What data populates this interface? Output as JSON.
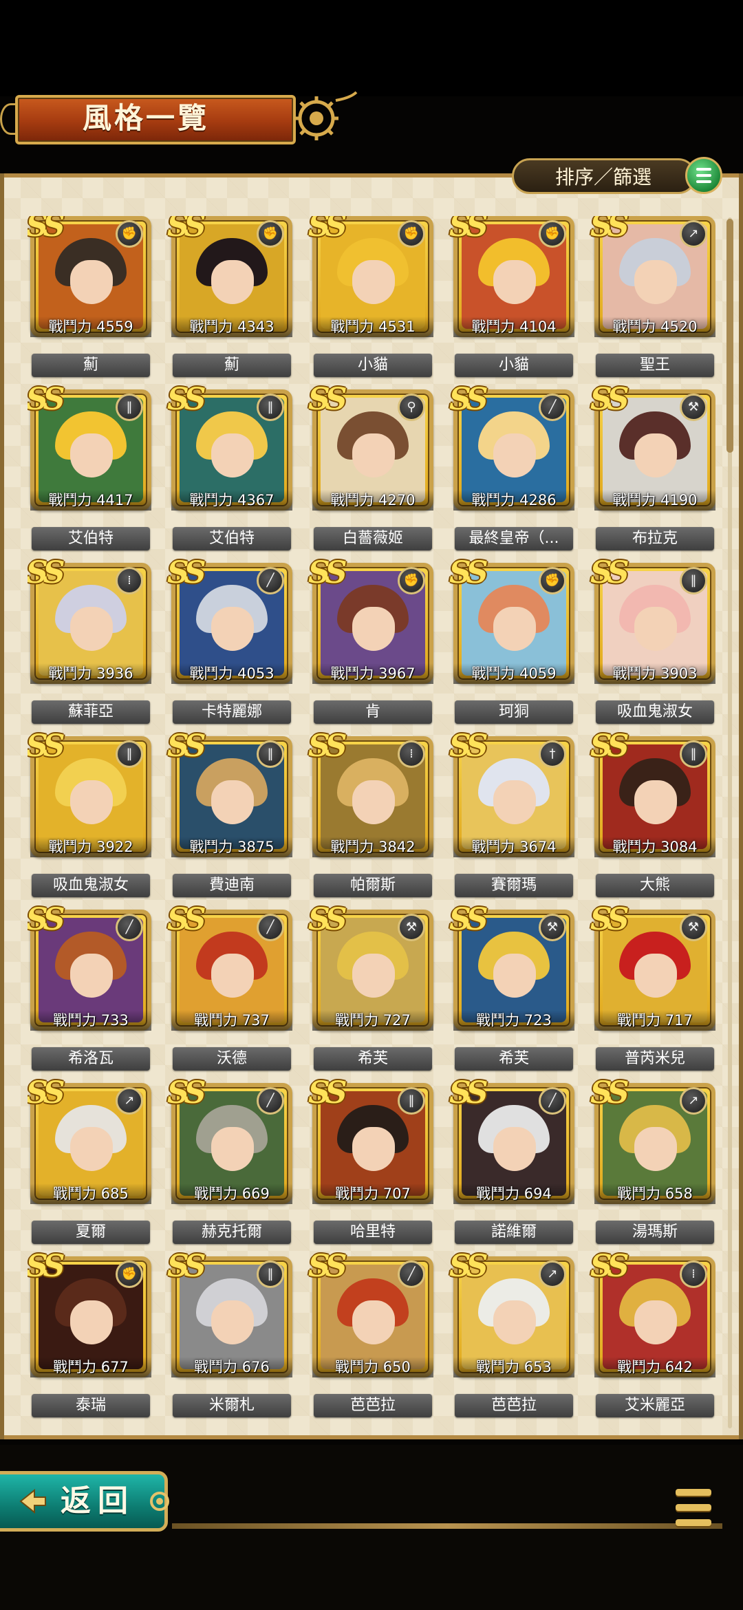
{
  "header": {
    "title": "風格一覽"
  },
  "toolbar": {
    "sort_label": "排序／篩選",
    "sort_icon": "hamburger-menu-icon"
  },
  "footer": {
    "back_label": "返回",
    "menu_icon": "hamburger-menu-icon"
  },
  "rarity_label": "SS",
  "colors": {
    "frame_gold": "#caa24a",
    "accent_teal": "#0d7d72",
    "title_orange": "#b8461a"
  },
  "characters": [
    {
      "name": "薊",
      "power": "戰鬥力 4559",
      "weapon": "fist-icon",
      "hair": "#3a2e24",
      "bg": "#c2611c"
    },
    {
      "name": "薊",
      "power": "戰鬥力 4343",
      "weapon": "fist-icon",
      "hair": "#22181a",
      "bg": "#d8a726"
    },
    {
      "name": "小貓",
      "power": "戰鬥力 4531",
      "weapon": "fist-icon",
      "hair": "#f0c030",
      "bg": "#e7b429"
    },
    {
      "name": "小貓",
      "power": "戰鬥力 4104",
      "weapon": "fist-icon",
      "hair": "#f2be2c",
      "bg": "#c9522a"
    },
    {
      "name": "聖王",
      "power": "戰鬥力 4520",
      "weapon": "spear-icon",
      "hair": "#c9ced8",
      "bg": "#e5b9a6"
    },
    {
      "name": "艾伯特",
      "power": "戰鬥力 4417",
      "weapon": "greatsword-icon",
      "hair": "#f2c431",
      "bg": "#3f7a3c"
    },
    {
      "name": "艾伯特",
      "power": "戰鬥力 4367",
      "weapon": "greatsword-icon",
      "hair": "#f0c84a",
      "bg": "#2c6e66"
    },
    {
      "name": "白薔薇姬",
      "power": "戰鬥力 4270",
      "weapon": "staff-icon",
      "hair": "#7a4f32",
      "bg": "#e7d6b0"
    },
    {
      "name": "最終皇帝（...",
      "power": "戰鬥力 4286",
      "weapon": "sword-icon",
      "hair": "#f3d48a",
      "bg": "#2a6ea0"
    },
    {
      "name": "布拉克",
      "power": "戰鬥力 4190",
      "weapon": "axe-icon",
      "hair": "#5a2f2a",
      "bg": "#d7d4cc"
    },
    {
      "name": "蘇菲亞",
      "power": "戰鬥力 3936",
      "weapon": "gun-icon",
      "hair": "#cfcfe0",
      "bg": "#e7c14a"
    },
    {
      "name": "卡特麗娜",
      "power": "戰鬥力 4053",
      "weapon": "sword-icon",
      "hair": "#c9d0dc",
      "bg": "#2f4f8a"
    },
    {
      "name": "肯",
      "power": "戰鬥力 3967",
      "weapon": "fist-icon",
      "hair": "#7a3a2a",
      "bg": "#6b4a8a"
    },
    {
      "name": "珂狪",
      "power": "戰鬥力 4059",
      "weapon": "fist-icon",
      "hair": "#e08a60",
      "bg": "#8ac0d8"
    },
    {
      "name": "吸血鬼淑女",
      "power": "戰鬥力 3903",
      "weapon": "greatsword-icon",
      "hair": "#f2b8b0",
      "bg": "#f0d0c0"
    },
    {
      "name": "吸血鬼淑女",
      "power": "戰鬥力 3922",
      "weapon": "greatsword-icon",
      "hair": "#f2d050",
      "bg": "#e3b22a"
    },
    {
      "name": "費迪南",
      "power": "戰鬥力 3875",
      "weapon": "greatsword-icon",
      "hair": "#c9a060",
      "bg": "#2a4f6a"
    },
    {
      "name": "帕爾斯",
      "power": "戰鬥力 3842",
      "weapon": "gun-icon",
      "hair": "#d9b060",
      "bg": "#9a7a30"
    },
    {
      "name": "賽爾瑪",
      "power": "戰鬥力 3674",
      "weapon": "rapier-icon",
      "hair": "#e0e4ee",
      "bg": "#e8c45a"
    },
    {
      "name": "大熊",
      "power": "戰鬥力 3084",
      "weapon": "greatsword-icon",
      "hair": "#3a2218",
      "bg": "#a02a1e"
    },
    {
      "name": "希洛瓦",
      "power": "戰鬥力 733",
      "weapon": "sword-icon",
      "hair": "#b35a28",
      "bg": "#6a3a7a"
    },
    {
      "name": "沃德",
      "power": "戰鬥力 737",
      "weapon": "sword-icon",
      "hair": "#c23a1e",
      "bg": "#e0a030"
    },
    {
      "name": "希芙",
      "power": "戰鬥力 727",
      "weapon": "axe-icon",
      "hair": "#e3c048",
      "bg": "#c8a850"
    },
    {
      "name": "希芙",
      "power": "戰鬥力 723",
      "weapon": "axe-icon",
      "hair": "#e8c240",
      "bg": "#2a5a8a"
    },
    {
      "name": "普芮米兒",
      "power": "戰鬥力 717",
      "weapon": "axe-icon",
      "hair": "#c8201e",
      "bg": "#e0b030"
    },
    {
      "name": "夏爾",
      "power": "戰鬥力 685",
      "weapon": "spear-icon",
      "hair": "#e6e2da",
      "bg": "#e3b12a"
    },
    {
      "name": "赫克托爾",
      "power": "戰鬥力 669",
      "weapon": "sword-icon",
      "hair": "#a0a090",
      "bg": "#4a6a3a"
    },
    {
      "name": "哈里特",
      "power": "戰鬥力 707",
      "weapon": "greatsword-icon",
      "hair": "#2a1e18",
      "bg": "#a0401a"
    },
    {
      "name": "諾維爾",
      "power": "戰鬥力 694",
      "weapon": "sword-icon",
      "hair": "#e0e0e0",
      "bg": "#3a2a2a"
    },
    {
      "name": "湯瑪斯",
      "power": "戰鬥力 658",
      "weapon": "spear-icon",
      "hair": "#d8b848",
      "bg": "#5a7a3a"
    },
    {
      "name": "泰瑞",
      "power": "戰鬥力 677",
      "weapon": "fist-icon",
      "hair": "#5a2a1a",
      "bg": "#3a1a12"
    },
    {
      "name": "米爾札",
      "power": "戰鬥力 676",
      "weapon": "greatsword-icon",
      "hair": "#d0d0d4",
      "bg": "#8a8a8a"
    },
    {
      "name": "芭芭拉",
      "power": "戰鬥力 650",
      "weapon": "sword-icon",
      "hair": "#c2401e",
      "bg": "#c89a50"
    },
    {
      "name": "芭芭拉",
      "power": "戰鬥力 653",
      "weapon": "spear-icon",
      "hair": "#ecece6",
      "bg": "#e8c050"
    },
    {
      "name": "艾米麗亞",
      "power": "戰鬥力 642",
      "weapon": "gun-icon",
      "hair": "#e0b040",
      "bg": "#b0302a"
    }
  ]
}
